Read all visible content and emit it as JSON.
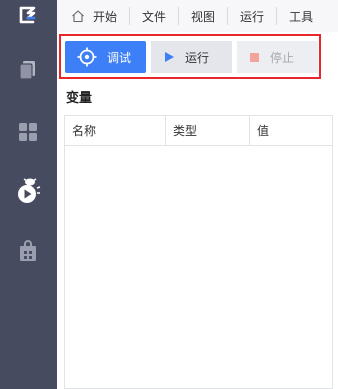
{
  "menu": {
    "items": [
      {
        "label": "开始",
        "icon": "home-icon"
      },
      {
        "label": "文件"
      },
      {
        "label": "视图"
      },
      {
        "label": "运行"
      },
      {
        "label": "工具"
      }
    ]
  },
  "sidebar": {
    "items": [
      {
        "icon": "files-icon"
      },
      {
        "icon": "components-icon"
      },
      {
        "icon": "debug-run-icon"
      },
      {
        "icon": "package-icon"
      }
    ]
  },
  "toolbar": {
    "debug_label": "调试",
    "run_label": "运行",
    "stop_label": "停止"
  },
  "variables": {
    "title": "变量",
    "columns": [
      "名称",
      "类型",
      "值"
    ],
    "rows": []
  },
  "colors": {
    "sidebar_bg": "#474b5f",
    "accent_blue": "#3d7ff6",
    "highlight_red": "#e8262c"
  }
}
